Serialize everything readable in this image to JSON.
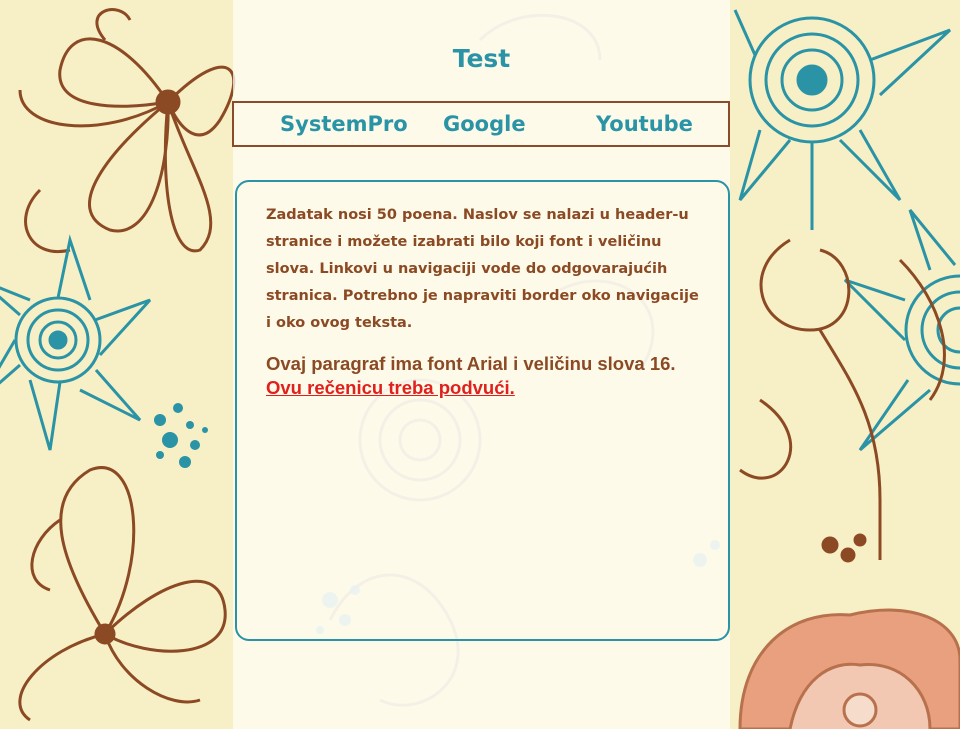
{
  "header": {
    "title": "Test"
  },
  "nav": {
    "links": [
      {
        "label": "SystemPro"
      },
      {
        "label": "Google"
      },
      {
        "label": "Youtube"
      }
    ]
  },
  "content": {
    "paragraph1": "Zadatak nosi 50 poena. Naslov se nalazi u header-u stranice i možete izabrati bilo koji font i veličinu slova. Linkovi u navigaciji vode do odgovarajućih stranica. Potrebno je napraviti border oko navigacije i oko ovog teksta.",
    "paragraph2_text": "Ovaj paragraf ima font Arial i veličinu slova 16. ",
    "paragraph2_link": "Ovu rečenicu treba podvući."
  },
  "colors": {
    "background": "#f7efc6",
    "teal": "#2a93a6",
    "brown": "#8b4a24",
    "link_red": "#e0201c",
    "nav_border": "#8a4b2a"
  }
}
